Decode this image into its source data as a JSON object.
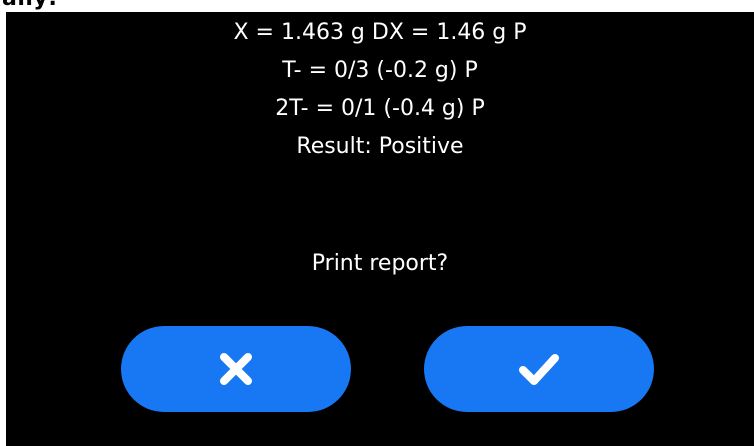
{
  "header": {
    "clipped_text": "ally:"
  },
  "result": {
    "line1": "X = 1.463 g DX = 1.46 g P",
    "line2": "T- = 0/3 (-0.2 g) P",
    "line3": "2T- = 0/1 (-0.4 g) P",
    "line4": "Result: Positive"
  },
  "dialog": {
    "prompt": "Print report?"
  },
  "buttons": {
    "cancel_icon": "x-icon",
    "confirm_icon": "checkmark-icon"
  },
  "colors": {
    "background": "#000000",
    "button": "#1877f2",
    "text": "#ffffff"
  }
}
